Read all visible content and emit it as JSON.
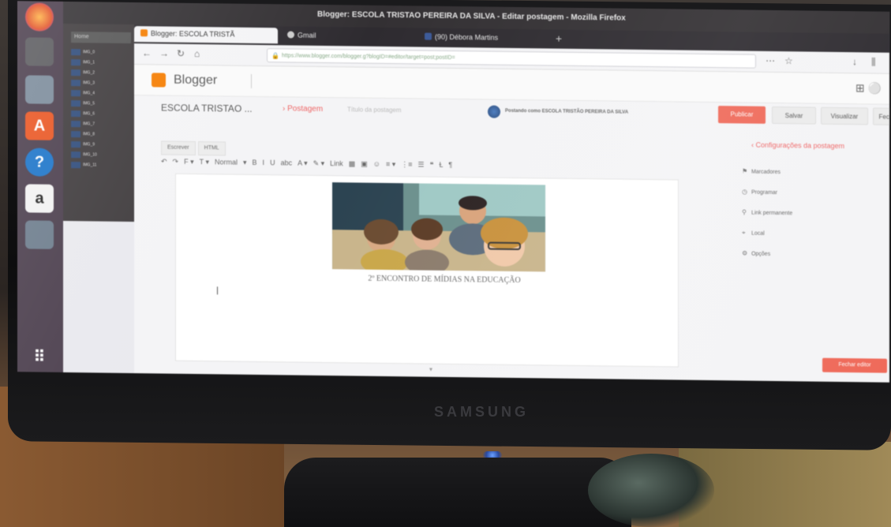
{
  "window": {
    "title": "Blogger: ESCOLA TRISTAO PEREIRA DA SILVA - Editar postagem - Mozilla Firefox",
    "monitor_brand": "SAMSUNG"
  },
  "launcher": {
    "icons": [
      "firefox-icon",
      "files-icon",
      "files-icon",
      "software-center-icon",
      "help-icon",
      "amazon-icon",
      "drive-icon",
      "apps-grid-icon"
    ],
    "amazon_label": "a"
  },
  "file_manager": {
    "header": "Home",
    "items": [
      "IMG_0",
      "IMG_1",
      "IMG_2",
      "IMG_3",
      "IMG_4",
      "IMG_5",
      "IMG_6",
      "IMG_7",
      "IMG_8",
      "IMG_9",
      "IMG_10",
      "IMG_11"
    ]
  },
  "browser": {
    "tabs": [
      {
        "label": "Blogger: ESCOLA TRISTÃ",
        "active": true,
        "favicon_color": "#f57d00"
      },
      {
        "label": "Gmail",
        "active": false,
        "favicon_color": "#cccccc"
      },
      {
        "label": "(90) Débora Martins",
        "active": false,
        "favicon_color": "#3b5998"
      }
    ],
    "url": "https://www.blogger.com/blogger.g?blogID=#editor/target=post;postID=",
    "new_tab_label": "+"
  },
  "blogger": {
    "app_name": "Blogger",
    "blog_title": "ESCOLA TRISTAO ...",
    "breadcrumb": "› Postagem",
    "post_title_placeholder": "Título da postagem",
    "author_line": "Postando como ESCOLA TRISTÃO PEREIRA DA SILVA",
    "buttons": {
      "publish": "Publicar",
      "save": "Salvar",
      "preview": "Visualizar",
      "close": "Fechar"
    },
    "modes": [
      "Escrever",
      "HTML"
    ],
    "toolbar": [
      "↶",
      "↷",
      "F ▾",
      "T ▾",
      "Normal",
      "▾",
      "B",
      "I",
      "U",
      "abc",
      "A ▾",
      "✎ ▾",
      "Link",
      "▦",
      "▣",
      "☺",
      "≡ ▾",
      "⋮≡",
      "☰",
      "❝",
      "Ɫ",
      "¶"
    ],
    "caption": "2º ENCONTRO  DE   MÍDIAS NA EDUCAÇÃO",
    "side_panel": {
      "title": "‹ Configurações da postagem",
      "items": [
        {
          "icon": "⚑",
          "label": "Marcadores"
        },
        {
          "icon": "◷",
          "label": "Programar"
        },
        {
          "icon": "⚲",
          "label": "Link permanente"
        },
        {
          "icon": "⌖",
          "label": "Local"
        },
        {
          "icon": "⚙",
          "label": "Opções"
        }
      ]
    },
    "close_button": "Fechar editor"
  }
}
